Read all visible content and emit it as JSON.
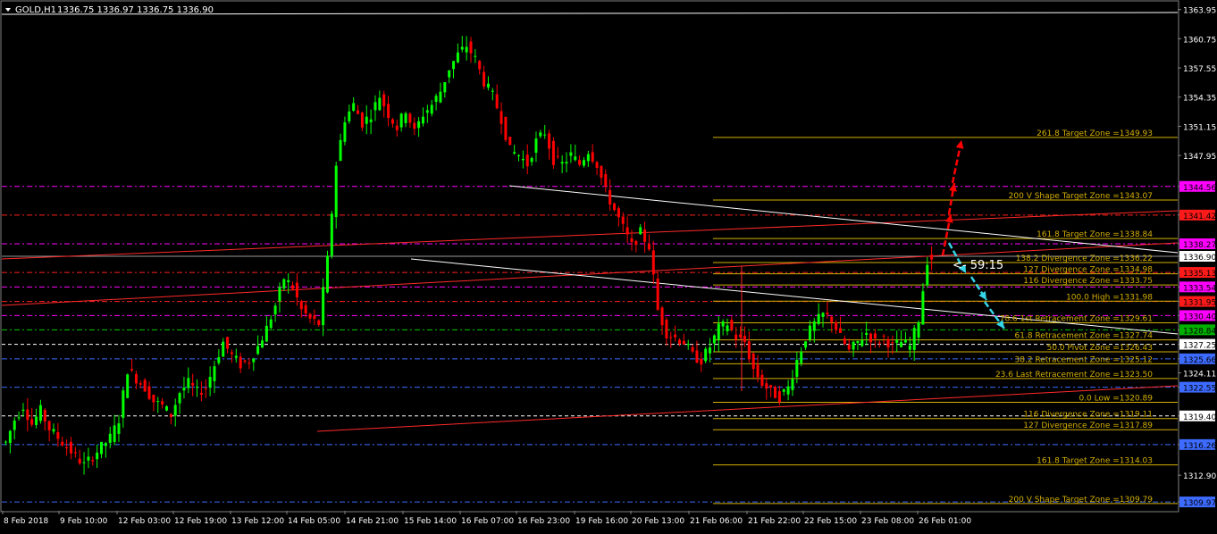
{
  "header": {
    "symbol_label": "GOLD,H1",
    "ohlc_label": "1336.75 1336.97 1336.75 1336.90"
  },
  "countdown": "<- 59:15",
  "price_axis": {
    "ticks": [
      "1363.95",
      "1360.75",
      "1357.55",
      "1354.35",
      "1351.15",
      "1347.95",
      "1344.56",
      "1341.42",
      "1338.27",
      "1336.90",
      "1335.13",
      "1333.54",
      "1331.95",
      "1330.40",
      "1328.84",
      "1327.25",
      "1325.66",
      "1324.11",
      "1322.55",
      "1319.40",
      "1316.26",
      "1312.90",
      "1309.97"
    ]
  },
  "time_axis": {
    "labels": [
      "8 Feb 2018",
      "9 Feb 10:00",
      "12 Feb 03:00",
      "12 Feb 19:00",
      "13 Feb 12:00",
      "14 Feb 05:00",
      "14 Feb 21:00",
      "15 Feb 14:00",
      "16 Feb 07:00",
      "16 Feb 23:00",
      "19 Feb 16:00",
      "20 Feb 13:00",
      "21 Feb 06:00",
      "21 Feb 22:00",
      "22 Feb 15:00",
      "23 Feb 08:00",
      "26 Feb 01:00"
    ]
  },
  "colors": {
    "background": "#000000",
    "bull_candle": "#00ff00",
    "bear_candle": "#ff0000",
    "fib_line": "#d4b000",
    "magenta_level": "#ff00ff",
    "red_level": "#ff2020",
    "green_level": "#00cc00",
    "blue_level": "#3d6bff",
    "white_level": "#ffffff",
    "trend_red": "#ff2a2a",
    "trend_white": "#ffffff",
    "up_arrow": "#ff0000",
    "down_arrow": "#34d5e8",
    "tag_magenta": "#ff00ff",
    "tag_red": "#ff1a1a",
    "tag_green": "#00b000",
    "tag_blue": "#3d6bff"
  },
  "chart_data": {
    "type": "candlestick",
    "symbol": "GOLD",
    "timeframe": "H1",
    "ylim": [
      1309.0,
      1364.8
    ],
    "price_levels": [
      {
        "price": 1344.56,
        "color": "magenta",
        "tag": "1344.56"
      },
      {
        "price": 1341.42,
        "color": "red",
        "tag": "1341.42"
      },
      {
        "price": 1338.27,
        "color": "magenta",
        "tag": "1338.27"
      },
      {
        "price": 1336.9,
        "color": "bid",
        "tag": "1336.90"
      },
      {
        "price": 1335.13,
        "color": "red",
        "tag": "1335.13"
      },
      {
        "price": 1333.54,
        "color": "magenta",
        "tag": "1333.54"
      },
      {
        "price": 1331.95,
        "color": "red",
        "tag": "1331.95"
      },
      {
        "price": 1330.4,
        "color": "magenta",
        "tag": "1330.40"
      },
      {
        "price": 1328.84,
        "color": "green",
        "tag": "1328.84"
      },
      {
        "price": 1327.25,
        "color": "white",
        "tag": "1327.25"
      },
      {
        "price": 1325.66,
        "color": "blue",
        "tag": "1325.66"
      },
      {
        "price": 1322.55,
        "color": "blue",
        "tag": "1322.55"
      },
      {
        "price": 1319.4,
        "color": "white",
        "tag": "1319.40"
      },
      {
        "price": 1316.26,
        "color": "blue",
        "tag": "1316.26"
      },
      {
        "price": 1309.97,
        "color": "blue",
        "tag": "1309.97"
      }
    ],
    "fib_levels": [
      {
        "label": "261.8 Target Zone =1349.93",
        "price": 1349.93
      },
      {
        "label": "200  V Shape Target Zone =1343.07",
        "price": 1343.07
      },
      {
        "label": "161.8 Target Zone =1338.84",
        "price": 1338.84
      },
      {
        "label": "138.2 Divergence Zone =1336.22",
        "price": 1336.22
      },
      {
        "label": "127 Divergence Zone =1334.98",
        "price": 1334.98
      },
      {
        "label": "116 Divergence Zone =1333.75",
        "price": 1333.75
      },
      {
        "label": "100.0 High =1331.98",
        "price": 1331.98
      },
      {
        "label": "78.6 1st Retracement Zone =1329.61",
        "price": 1329.61
      },
      {
        "label": "61.8 Retracement Zone =1327.74",
        "price": 1327.74
      },
      {
        "label": "50.0 Pivot Zone =1326.43",
        "price": 1326.43
      },
      {
        "label": "38.2 Retracement Zone =1325.12",
        "price": 1325.12
      },
      {
        "label": "23.6 Last Retracement Zone =1323.50",
        "price": 1323.5
      },
      {
        "label": "0.0 Low =1320.89",
        "price": 1320.89
      },
      {
        "label": "116 Divergence Zone =1319.11",
        "price": 1319.11
      },
      {
        "label": "127 Divergence Zone =1317.89",
        "price": 1317.89
      },
      {
        "label": "161.8 Target Zone =1314.03",
        "price": 1314.03
      },
      {
        "label": "200  V Shape Target Zone =1309.79",
        "price": 1309.79
      }
    ],
    "candles_close_path": [
      [
        0,
        1316.5
      ],
      [
        2,
        1319.0
      ],
      [
        4,
        1320.5
      ],
      [
        6,
        1318.5
      ],
      [
        8,
        1320.0
      ],
      [
        10,
        1318.0
      ],
      [
        12,
        1317.0
      ],
      [
        14,
        1316.0
      ],
      [
        16,
        1315.0
      ],
      [
        18,
        1314.0
      ],
      [
        20,
        1315.0
      ],
      [
        22,
        1316.0
      ],
      [
        24,
        1317.0
      ],
      [
        26,
        1319.0
      ],
      [
        28,
        1324.5
      ],
      [
        30,
        1323.5
      ],
      [
        32,
        1322.5
      ],
      [
        34,
        1321.0
      ],
      [
        36,
        1320.5
      ],
      [
        38,
        1319.5
      ],
      [
        40,
        1322.0
      ],
      [
        42,
        1323.0
      ],
      [
        44,
        1322.0
      ],
      [
        46,
        1322.5
      ],
      [
        48,
        1325.0
      ],
      [
        50,
        1327.5
      ],
      [
        52,
        1326.0
      ],
      [
        54,
        1325.0
      ],
      [
        56,
        1325.5
      ],
      [
        58,
        1327.0
      ],
      [
        60,
        1329.0
      ],
      [
        62,
        1331.5
      ],
      [
        64,
        1334.5
      ],
      [
        66,
        1333.5
      ],
      [
        68,
        1331.0
      ],
      [
        70,
        1330.0
      ],
      [
        72,
        1329.5
      ],
      [
        74,
        1336.5
      ],
      [
        76,
        1347.0
      ],
      [
        78,
        1352.0
      ],
      [
        80,
        1353.5
      ],
      [
        82,
        1351.5
      ],
      [
        84,
        1352.5
      ],
      [
        86,
        1354.5
      ],
      [
        88,
        1352.5
      ],
      [
        90,
        1351.0
      ],
      [
        92,
        1353.0
      ],
      [
        94,
        1350.5
      ],
      [
        96,
        1352.5
      ],
      [
        98,
        1353.5
      ],
      [
        100,
        1355.0
      ],
      [
        102,
        1357.5
      ],
      [
        104,
        1359.0
      ],
      [
        106,
        1360.0
      ],
      [
        108,
        1358.5
      ],
      [
        110,
        1356.0
      ],
      [
        112,
        1354.5
      ],
      [
        114,
        1352.0
      ],
      [
        116,
        1348.5
      ],
      [
        118,
        1348.0
      ],
      [
        120,
        1347.0
      ],
      [
        122,
        1349.5
      ],
      [
        124,
        1350.5
      ],
      [
        126,
        1347.5
      ],
      [
        128,
        1347.0
      ],
      [
        130,
        1348.0
      ],
      [
        132,
        1347.0
      ],
      [
        134,
        1348.5
      ],
      [
        136,
        1347.0
      ],
      [
        138,
        1344.0
      ],
      [
        140,
        1342.0
      ],
      [
        142,
        1340.0
      ],
      [
        144,
        1338.0
      ],
      [
        146,
        1339.5
      ],
      [
        148,
        1338.0
      ],
      [
        150,
        1331.0
      ],
      [
        152,
        1328.5
      ],
      [
        154,
        1328.0
      ],
      [
        156,
        1327.5
      ],
      [
        158,
        1326.0
      ],
      [
        160,
        1325.5
      ],
      [
        162,
        1327.0
      ],
      [
        164,
        1329.0
      ],
      [
        166,
        1329.5
      ],
      [
        168,
        1328.0
      ],
      [
        170,
        1327.5
      ],
      [
        172,
        1324.5
      ],
      [
        174,
        1323.0
      ],
      [
        176,
        1322.0
      ],
      [
        178,
        1321.5
      ],
      [
        180,
        1322.5
      ],
      [
        182,
        1325.5
      ],
      [
        184,
        1328.0
      ],
      [
        186,
        1329.5
      ],
      [
        188,
        1330.5
      ],
      [
        190,
        1330.0
      ],
      [
        192,
        1328.0
      ],
      [
        194,
        1326.5
      ],
      [
        196,
        1327.5
      ],
      [
        198,
        1328.5
      ],
      [
        200,
        1327.5
      ],
      [
        202,
        1328.0
      ],
      [
        204,
        1327.0
      ],
      [
        206,
        1327.5
      ],
      [
        208,
        1327.0
      ],
      [
        210,
        1330.0
      ],
      [
        212,
        1336.5
      ],
      [
        214,
        1336.9
      ]
    ],
    "annotation_arrows": [
      {
        "direction": "up",
        "color": "red"
      },
      {
        "direction": "up",
        "color": "red"
      },
      {
        "direction": "up",
        "color": "red"
      },
      {
        "direction": "down",
        "color": "cyan"
      },
      {
        "direction": "down",
        "color": "cyan"
      }
    ]
  }
}
